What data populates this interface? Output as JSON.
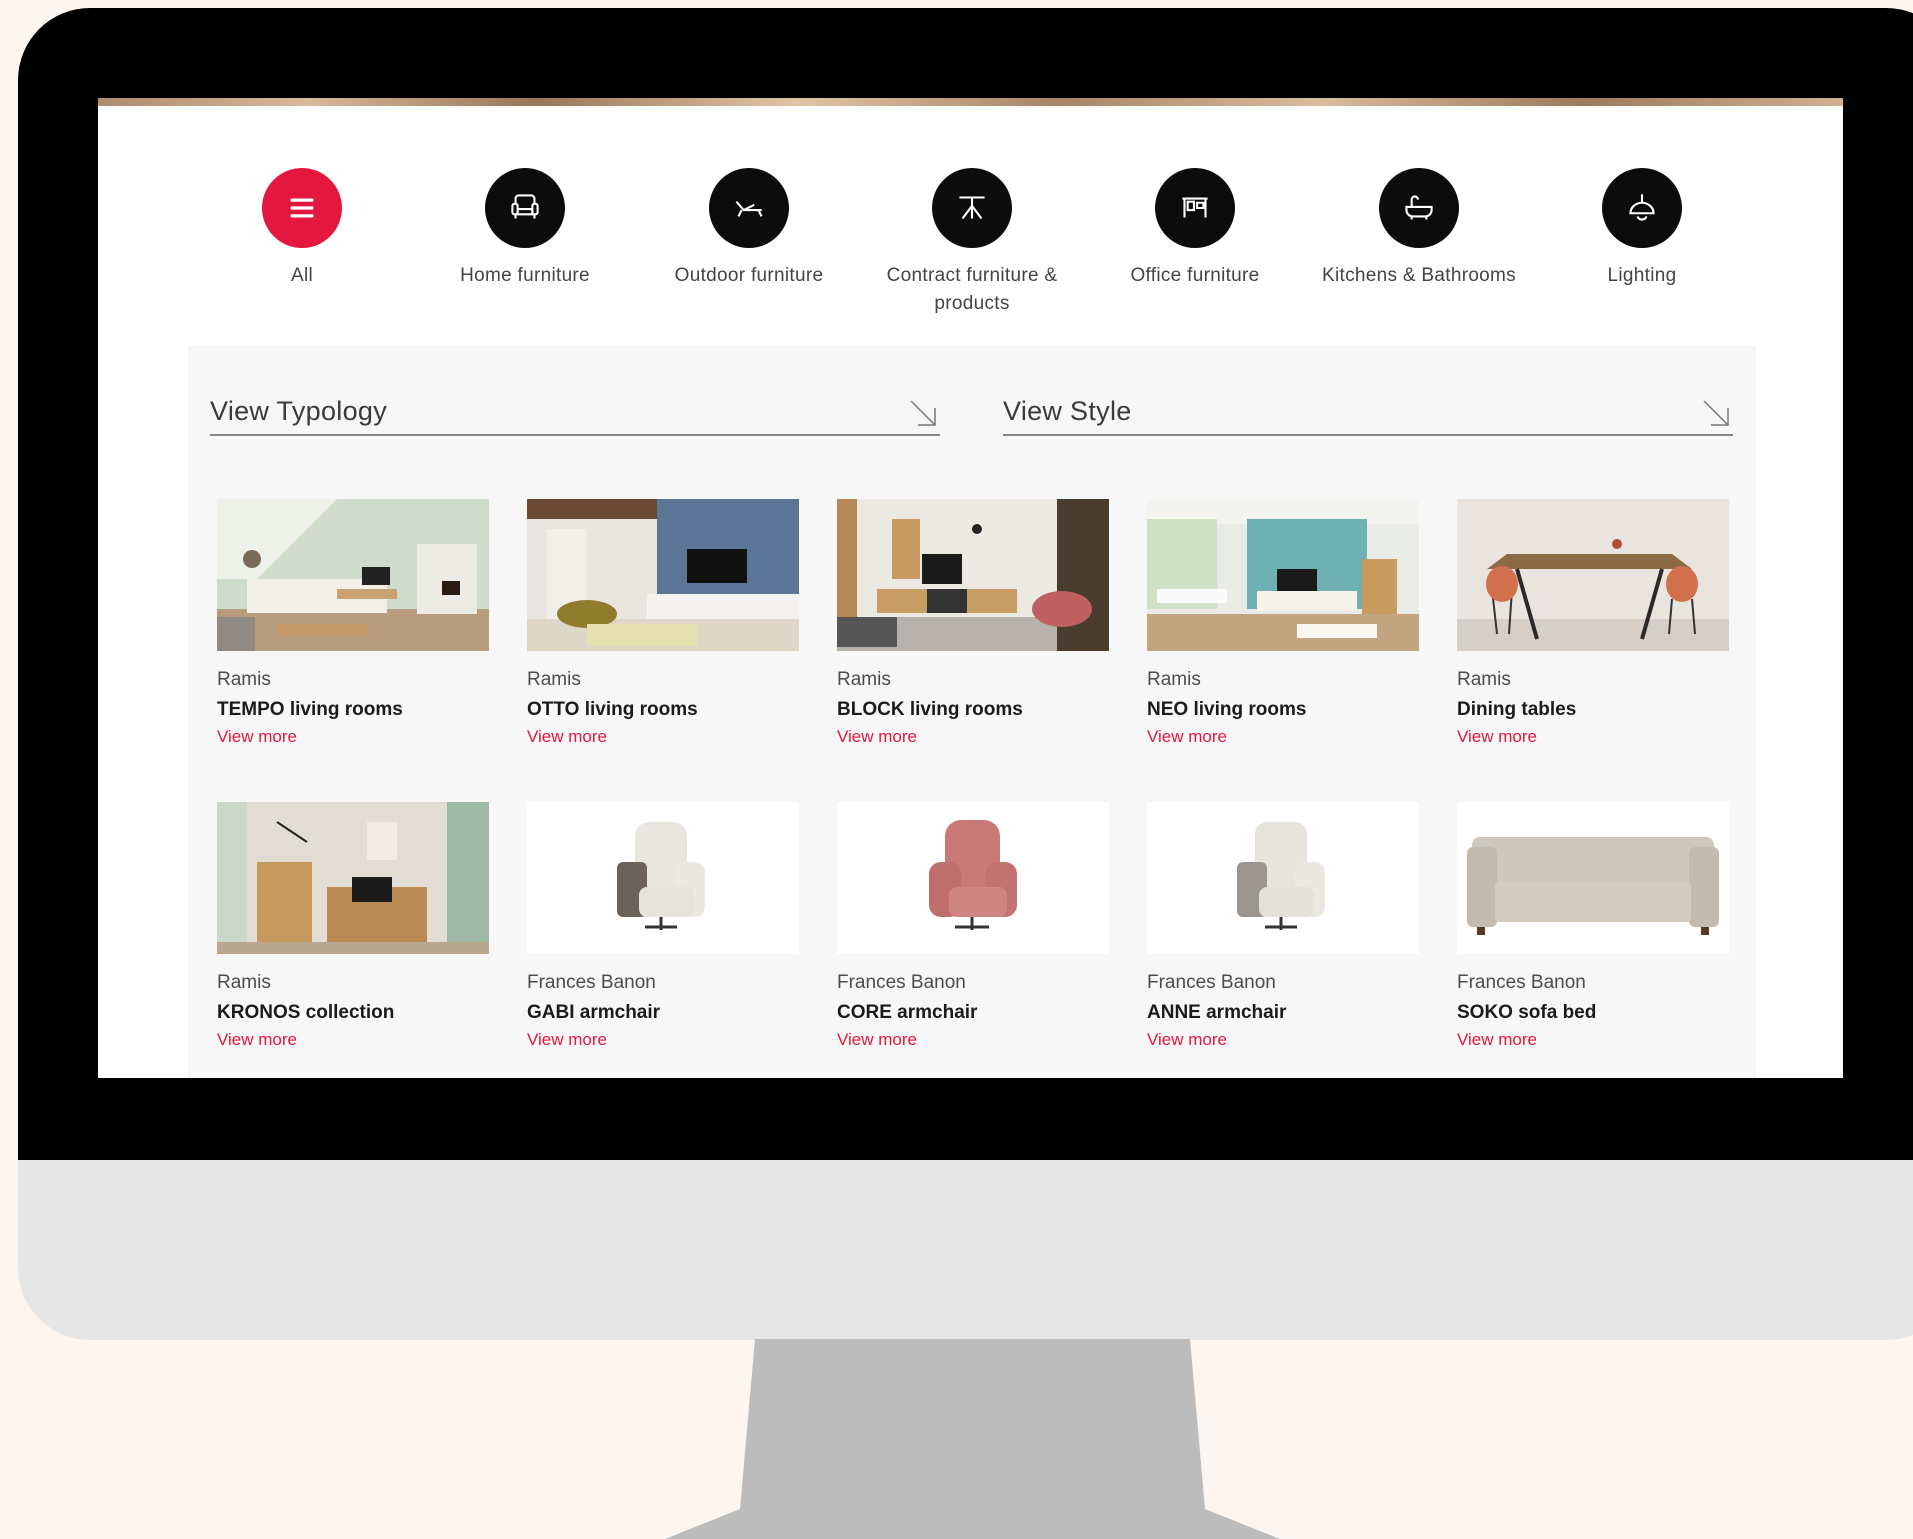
{
  "categories": [
    {
      "label": "All",
      "icon": "menu-icon",
      "active": true
    },
    {
      "label": "Home furniture",
      "icon": "armchair-icon"
    },
    {
      "label": "Outdoor furniture",
      "icon": "sun-lounger-icon"
    },
    {
      "label": "Contract furniture & products",
      "icon": "table-icon"
    },
    {
      "label": "Office furniture",
      "icon": "desk-icon"
    },
    {
      "label": "Kitchens & Bathrooms",
      "icon": "bathtub-icon"
    },
    {
      "label": "Lighting",
      "icon": "ceiling-lamp-icon"
    }
  ],
  "filters": {
    "typology": "View Typology",
    "style": "View Style"
  },
  "products": [
    {
      "brand": "Ramis",
      "name": "TEMPO living rooms",
      "link": "View more",
      "image": "living-room-photo"
    },
    {
      "brand": "Ramis",
      "name": "OTTO living rooms",
      "link": "View more",
      "image": "living-room-photo"
    },
    {
      "brand": "Ramis",
      "name": "BLOCK living rooms",
      "link": "View more",
      "image": "living-room-photo"
    },
    {
      "brand": "Ramis",
      "name": "NEO living rooms",
      "link": "View more",
      "image": "living-room-photo"
    },
    {
      "brand": "Ramis",
      "name": "Dining tables",
      "link": "View more",
      "image": "dining-table-photo"
    },
    {
      "brand": "Ramis",
      "name": "KRONOS collection",
      "link": "View more",
      "image": "living-room-photo"
    },
    {
      "brand": "Frances Banon",
      "name": "GABI armchair",
      "link": "View more",
      "image": "armchair-photo"
    },
    {
      "brand": "Frances Banon",
      "name": "CORE armchair",
      "link": "View more",
      "image": "armchair-photo"
    },
    {
      "brand": "Frances Banon",
      "name": "ANNE armchair",
      "link": "View more",
      "image": "armchair-photo"
    },
    {
      "brand": "Frances Banon",
      "name": "SOKO sofa bed",
      "link": "View more",
      "image": "sofa-photo"
    }
  ],
  "colors": {
    "accent": "#e3173f",
    "icon_bg": "#0c0c0c",
    "panel_bg": "#f7f7f7"
  }
}
